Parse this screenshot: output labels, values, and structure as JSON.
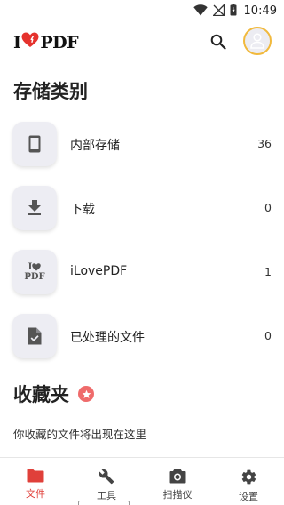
{
  "status_bar": {
    "time": "10:49"
  },
  "header": {
    "logo_left": "I",
    "logo_right": "PDF"
  },
  "storage": {
    "title": "存储类别",
    "items": [
      {
        "label": "内部存储",
        "count": "36",
        "icon": "phone-icon"
      },
      {
        "label": "下载",
        "count": "0",
        "icon": "download-icon"
      },
      {
        "label": "iLovePDF",
        "count": "1",
        "icon": "ilovepdf-logo-icon",
        "icon_text_top": "I",
        "icon_text_bottom": "PDF"
      },
      {
        "label": "已处理的文件",
        "count": "0",
        "icon": "checked-file-icon"
      }
    ]
  },
  "favorites": {
    "title": "收藏夹",
    "empty_note": "你收藏的文件将出现在这里"
  },
  "bottom_nav": {
    "items": [
      {
        "label": "文件",
        "icon": "folder-icon",
        "active": true
      },
      {
        "label": "工具",
        "icon": "wrench-icon",
        "active": false
      },
      {
        "label": "扫描仪",
        "icon": "camera-icon",
        "active": false
      },
      {
        "label": "设置",
        "icon": "gear-icon",
        "active": false
      }
    ]
  },
  "colors": {
    "accent": "#e0403a",
    "avatar_ring": "#f1b93d",
    "star_badge": "#ef6b6b",
    "icon_tile": "#ededf3"
  }
}
